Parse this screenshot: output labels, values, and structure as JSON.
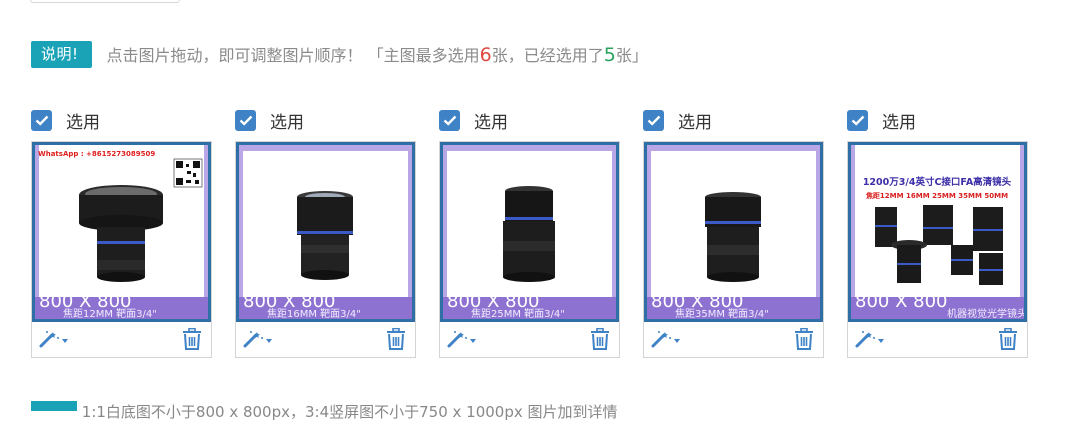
{
  "notice": {
    "badge": "说明!",
    "text_before": "点击图片拖动，即可调整图片顺序！ 「主图最多选用",
    "max_count": "6",
    "text_middle": "张，已经选用了",
    "selected_count": "5",
    "text_after": "张」"
  },
  "colors": {
    "accent_teal": "#1aa3b7",
    "checkbox_blue": "#3f82c6",
    "frame_blue": "#2e6fa6",
    "count_red": "#e0483f",
    "count_green": "#2aa25d"
  },
  "cards": [
    {
      "checked": true,
      "label": "选用",
      "size_label": "800 X 800",
      "lens_caption": "焦距12MM  靶面3/4\"",
      "overlay_left": "WhatsApp : +8615273089509",
      "icon_tool": "magic-wand-icon",
      "icon_delete": "trash-icon"
    },
    {
      "checked": true,
      "label": "选用",
      "size_label": "800 X 800",
      "lens_caption": "焦距16MM  靶面3/4\"",
      "icon_tool": "magic-wand-icon",
      "icon_delete": "trash-icon"
    },
    {
      "checked": true,
      "label": "选用",
      "size_label": "800 X 800",
      "lens_caption": "焦距25MM  靶面3/4\"",
      "icon_tool": "magic-wand-icon",
      "icon_delete": "trash-icon"
    },
    {
      "checked": true,
      "label": "选用",
      "size_label": "800 X 800",
      "lens_caption": "焦距35MM  靶面3/4\"",
      "icon_tool": "magic-wand-icon",
      "icon_delete": "trash-icon"
    },
    {
      "checked": true,
      "label": "选用",
      "size_label": "800 X 800",
      "banner_title": "1200万3/4英寸C接口FA高清镜头",
      "banner_sub": "焦距12MM 16MM 25MM 35MM 50MM",
      "lens_caption": "机器视觉光学镜头",
      "icon_tool": "magic-wand-icon",
      "icon_delete": "trash-icon"
    }
  ],
  "bottom": {
    "text": "1:1白底图不小于800 x 800px，3:4竖屏图不小于750 x 1000px  图片加到详情"
  }
}
